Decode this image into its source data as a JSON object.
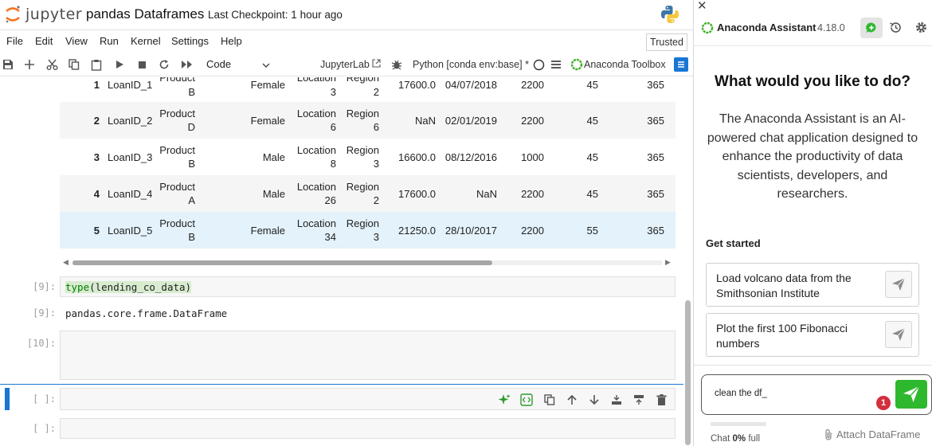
{
  "header": {
    "logo_text": "jupyter",
    "notebook_title": "pandas Dataframes",
    "checkpoint": "Last Checkpoint: 1 hour ago"
  },
  "menu": [
    "File",
    "Edit",
    "View",
    "Run",
    "Kernel",
    "Settings",
    "Help"
  ],
  "trusted_label": "Trusted",
  "toolbar": {
    "cell_type": "Code",
    "jupyterlab_label": "JupyterLab",
    "kernel": "Python [conda env:base] *",
    "toolbox_label": "Anaconda Toolbox"
  },
  "table": {
    "rows": [
      {
        "idx": "1",
        "id": "LoanID_1",
        "product": [
          "Product",
          "B"
        ],
        "gender": "Female",
        "location": [
          "Location",
          "3"
        ],
        "region": [
          "Region",
          "2"
        ],
        "amount": "17600.0",
        "date": "04/07/2018",
        "c8": "2200",
        "c9": "45",
        "c10": "365"
      },
      {
        "idx": "2",
        "id": "LoanID_2",
        "product": [
          "Product",
          "D"
        ],
        "gender": "Female",
        "location": [
          "Location",
          "6"
        ],
        "region": [
          "Region",
          "6"
        ],
        "amount": "NaN",
        "date": "02/01/2019",
        "c8": "2200",
        "c9": "45",
        "c10": "365"
      },
      {
        "idx": "3",
        "id": "LoanID_3",
        "product": [
          "Product",
          "B"
        ],
        "gender": "Male",
        "location": [
          "Location",
          "8"
        ],
        "region": [
          "Region",
          "3"
        ],
        "amount": "16600.0",
        "date": "08/12/2016",
        "c8": "1000",
        "c9": "45",
        "c10": "365"
      },
      {
        "idx": "4",
        "id": "LoanID_4",
        "product": [
          "Product",
          "A"
        ],
        "gender": "Male",
        "location": [
          "Location",
          "26"
        ],
        "region": [
          "Region",
          "2"
        ],
        "amount": "17600.0",
        "date": "NaN",
        "c8": "2200",
        "c9": "45",
        "c10": "365"
      },
      {
        "idx": "5",
        "id": "LoanID_5",
        "product": [
          "Product",
          "B"
        ],
        "gender": "Female",
        "location": [
          "Location",
          "34"
        ],
        "region": [
          "Region",
          "3"
        ],
        "amount": "21250.0",
        "date": "28/10/2017",
        "c8": "2200",
        "c9": "55",
        "c10": "365"
      }
    ]
  },
  "cells": {
    "c9_prompt": "[9]:",
    "c9_code_fn": "type",
    "c9_code_rest": "(lending_co_data)",
    "c9_out_prompt": "[9]:",
    "c9_output": "pandas.core.frame.DataFrame",
    "c10_prompt": "[10]:",
    "active_prompt": "[ ]:",
    "next_prompt": "[ ]:"
  },
  "assistant": {
    "title": "Anaconda Assistant",
    "version": "4.18.0",
    "question": "What would you like to do?",
    "description": "The Anaconda Assistant is an AI-powered chat application designed to enhance the productivity of data scientists, developers, and researchers.",
    "get_started": "Get started",
    "suggestions": [
      "Load volcano data from the Smithsonian Institute",
      "Plot the first 100 Fibonacci numbers"
    ],
    "chat_input": "clean the df_",
    "badge_count": "1",
    "quota_prefix": "Chat",
    "quota_value": "0%",
    "quota_suffix": "full",
    "quota_fraction": 0,
    "attach_label": "Attach DataFrame"
  },
  "colors": {
    "accent_blue": "#1976d2",
    "send_green": "#2eb82e",
    "badge_red": "#d32f3f",
    "row_highlight": "#e3f2fb"
  }
}
